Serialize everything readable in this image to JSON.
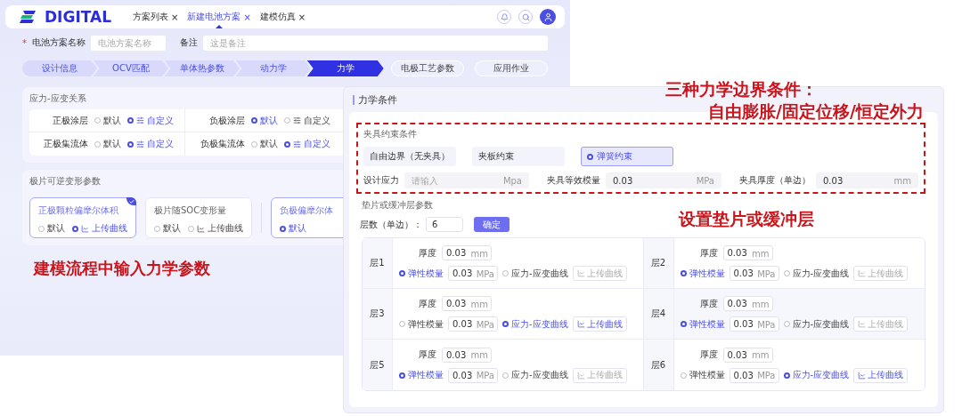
{
  "app": {
    "logo": "DIGITAL",
    "tabs": [
      {
        "label": "方案列表",
        "close": "×",
        "selected": false
      },
      {
        "label": "新建电池方案",
        "close": "×",
        "selected": true
      },
      {
        "label": "建模仿真",
        "close": "×",
        "selected": false
      }
    ],
    "form": {
      "required_mark": "*",
      "name_label": "电池方案名称",
      "name_placeholder": "电池方案名称",
      "note_label": "备注",
      "note_placeholder": "这是备注"
    },
    "steps": [
      {
        "label": "设计信息",
        "done": true,
        "selected": false
      },
      {
        "label": "OCV匹配",
        "done": true,
        "selected": false
      },
      {
        "label": "单体热参数",
        "done": true,
        "selected": false
      },
      {
        "label": "动力学",
        "done": true,
        "selected": false
      },
      {
        "label": "力学",
        "selected": true
      },
      {
        "label": "电极工艺参数",
        "done": false,
        "selected": false
      },
      {
        "label": "应用作业",
        "done": false,
        "selected": false
      }
    ],
    "stress_strain": {
      "title": "应力-应变关系",
      "rows": [
        {
          "label": "正极涂层",
          "options": [
            {
              "label": "默认",
              "kind": "plain",
              "selected": false
            },
            {
              "label": "自定义",
              "kind": "custom",
              "selected": true
            }
          ]
        },
        {
          "label": "负极涂层",
          "options": [
            {
              "label": "默认",
              "kind": "plain",
              "selected": true
            },
            {
              "label": "自定义",
              "kind": "custom",
              "selected": false
            }
          ]
        },
        {
          "label": "正极集流体",
          "options": [
            {
              "label": "默认",
              "kind": "plain",
              "selected": false
            },
            {
              "label": "自定义",
              "kind": "custom",
              "selected": true
            }
          ]
        },
        {
          "label": "负极集流体",
          "options": [
            {
              "label": "默认",
              "kind": "plain",
              "selected": false
            },
            {
              "label": "自定义",
              "kind": "custom",
              "selected": true
            }
          ]
        }
      ]
    },
    "deformation": {
      "title": "极片可逆变形参数",
      "cards": [
        {
          "title": "正极颗粒偏摩尔体积",
          "selected": true,
          "options": [
            {
              "label": "默认",
              "kind": "plain",
              "selected": false
            },
            {
              "label": "上传曲线",
              "kind": "upload",
              "selected": true
            }
          ]
        },
        {
          "title": "极片随SOC变形量",
          "selected": false,
          "options": [
            {
              "label": "默认",
              "kind": "plain",
              "selected": false
            },
            {
              "label": "上传曲线",
              "kind": "upload",
              "selected": false
            }
          ]
        },
        {
          "title": "负极偏摩尔体",
          "selected": true,
          "options": [
            {
              "label": "默认",
              "kind": "plain",
              "selected": true
            }
          ]
        }
      ]
    }
  },
  "panel": {
    "title": "力学条件",
    "fixture": {
      "title": "夹具约束条件",
      "options": [
        {
          "label": "自由边界（无夹具）",
          "selected": false
        },
        {
          "label": "夹板约束",
          "selected": false
        },
        {
          "label": "弹簧约束",
          "selected": true
        }
      ],
      "fields": [
        {
          "label": "设计应力",
          "placeholder": "请输入",
          "unit": "Mpa"
        },
        {
          "label": "夹具等效模量",
          "value": "0.03",
          "unit": "MPa"
        },
        {
          "label": "夹具厚度（单边）",
          "value": "0.03",
          "unit": "mm"
        }
      ]
    },
    "layers": {
      "title": "垫片或缓冲层参数",
      "count_label": "层数（单边）：",
      "count": "6",
      "confirm": "确定",
      "items": [
        {
          "name": "层1",
          "thickness_label": "厚度",
          "thickness": "0.03",
          "thickness_unit": "mm",
          "modulus_label": "弹性模量",
          "modulus": "0.03",
          "modulus_unit": "MPa",
          "modulus_selected": true,
          "curve_label": "应力-应变曲线",
          "curve_selected": false,
          "upload": "上传曲线"
        },
        {
          "name": "层2",
          "thickness_label": "厚度",
          "thickness": "0.03",
          "thickness_unit": "mm",
          "modulus_label": "弹性模量",
          "modulus": "0.03",
          "modulus_unit": "MPa",
          "modulus_selected": true,
          "curve_label": "应力-应变曲线",
          "curve_selected": false,
          "upload": "上传曲线"
        },
        {
          "name": "层3",
          "thickness_label": "厚度",
          "thickness": "0.03",
          "thickness_unit": "mm",
          "modulus_label": "弹性模量",
          "modulus": "0.03",
          "modulus_unit": "MPa",
          "modulus_selected": false,
          "curve_label": "应力-应变曲线",
          "curve_selected": true,
          "upload": "上传曲线"
        },
        {
          "name": "层4",
          "thickness_label": "厚度",
          "thickness": "0.03",
          "thickness_unit": "mm",
          "modulus_label": "弹性模量",
          "modulus": "0.03",
          "modulus_unit": "MPa",
          "modulus_selected": true,
          "curve_label": "应力-应变曲线",
          "curve_selected": false,
          "upload": "上传曲线"
        },
        {
          "name": "层5",
          "thickness_label": "厚度",
          "thickness": "0.03",
          "thickness_unit": "mm",
          "modulus_label": "弹性模量",
          "modulus": "0.03",
          "modulus_unit": "MPa",
          "modulus_selected": true,
          "curve_label": "应力-应变曲线",
          "curve_selected": false,
          "upload": "上传曲线"
        },
        {
          "name": "层6",
          "thickness_label": "厚度",
          "thickness": "0.03",
          "thickness_unit": "mm",
          "modulus_label": "弹性模量",
          "modulus": "0.03",
          "modulus_unit": "MPa",
          "modulus_selected": false,
          "curve_label": "应力-应变曲线",
          "curve_selected": true,
          "upload": "上传曲线"
        }
      ]
    }
  },
  "annotations": [
    {
      "text": "三种力学边界条件："
    },
    {
      "text": "自由膨胀/固定位移/恒定外力"
    },
    {
      "text": "设置垫片或缓冲层"
    },
    {
      "text": "建模流程中输入力学参数"
    }
  ]
}
